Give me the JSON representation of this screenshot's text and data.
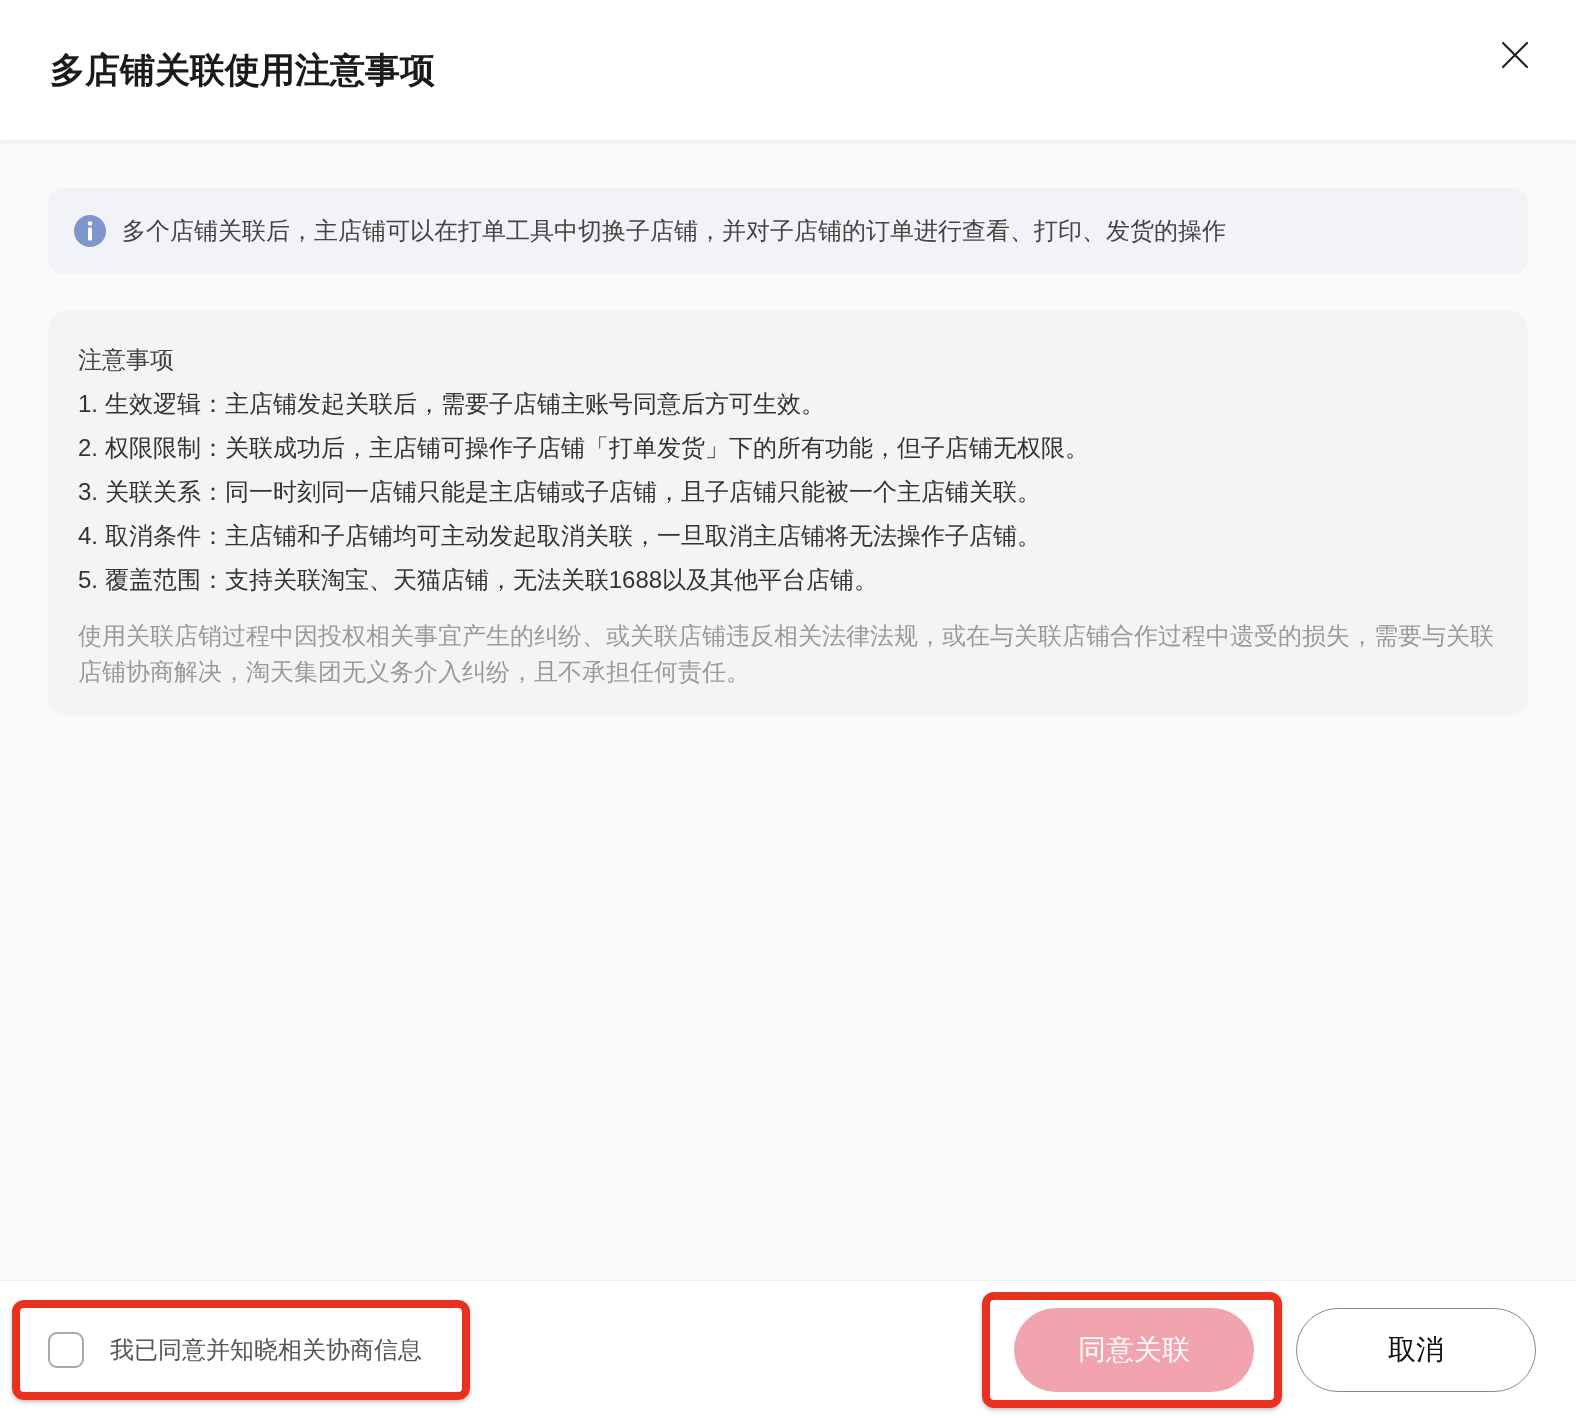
{
  "dialog": {
    "title": "多店铺关联使用注意事项"
  },
  "info_banner": {
    "text": "多个店铺关联后，主店铺可以在打单工具中切换子店铺，并对子店铺的订单进行查看、打印、发货的操作"
  },
  "notes": {
    "heading": "注意事项",
    "items": [
      "1. 生效逻辑：主店铺发起关联后，需要子店铺主账号同意后方可生效。",
      "2. 权限限制：关联成功后，主店铺可操作子店铺「打单发货」下的所有功能，但子店铺无权限。",
      "3. 关联关系：同一时刻同一店铺只能是主店铺或子店铺，且子店铺只能被一个主店铺关联。",
      "4. 取消条件：主店铺和子店铺均可主动发起取消关联，一旦取消主店铺将无法操作子店铺。",
      "5. 覆盖范围：支持关联淘宝、天猫店铺，无法关联1688以及其他平台店铺。"
    ],
    "disclaimer": "使用关联店销过程中因投权相关事宜产生的纠纷、或关联店铺违反相关法律法规，或在与关联店铺合作过程中遗受的损失，需要与关联店铺协商解决，淘天集团无义务介入纠纷，且不承担任何责任。"
  },
  "footer": {
    "agreement": {
      "label": "我已同意并知晓相关协商信息",
      "checked": false,
      "highlighted": true
    },
    "buttons": [
      {
        "kind": "primary",
        "label": "同意关联",
        "disabled": true,
        "highlighted": true
      },
      {
        "kind": "secondary",
        "label": "取消",
        "disabled": false,
        "highlighted": false
      }
    ]
  }
}
